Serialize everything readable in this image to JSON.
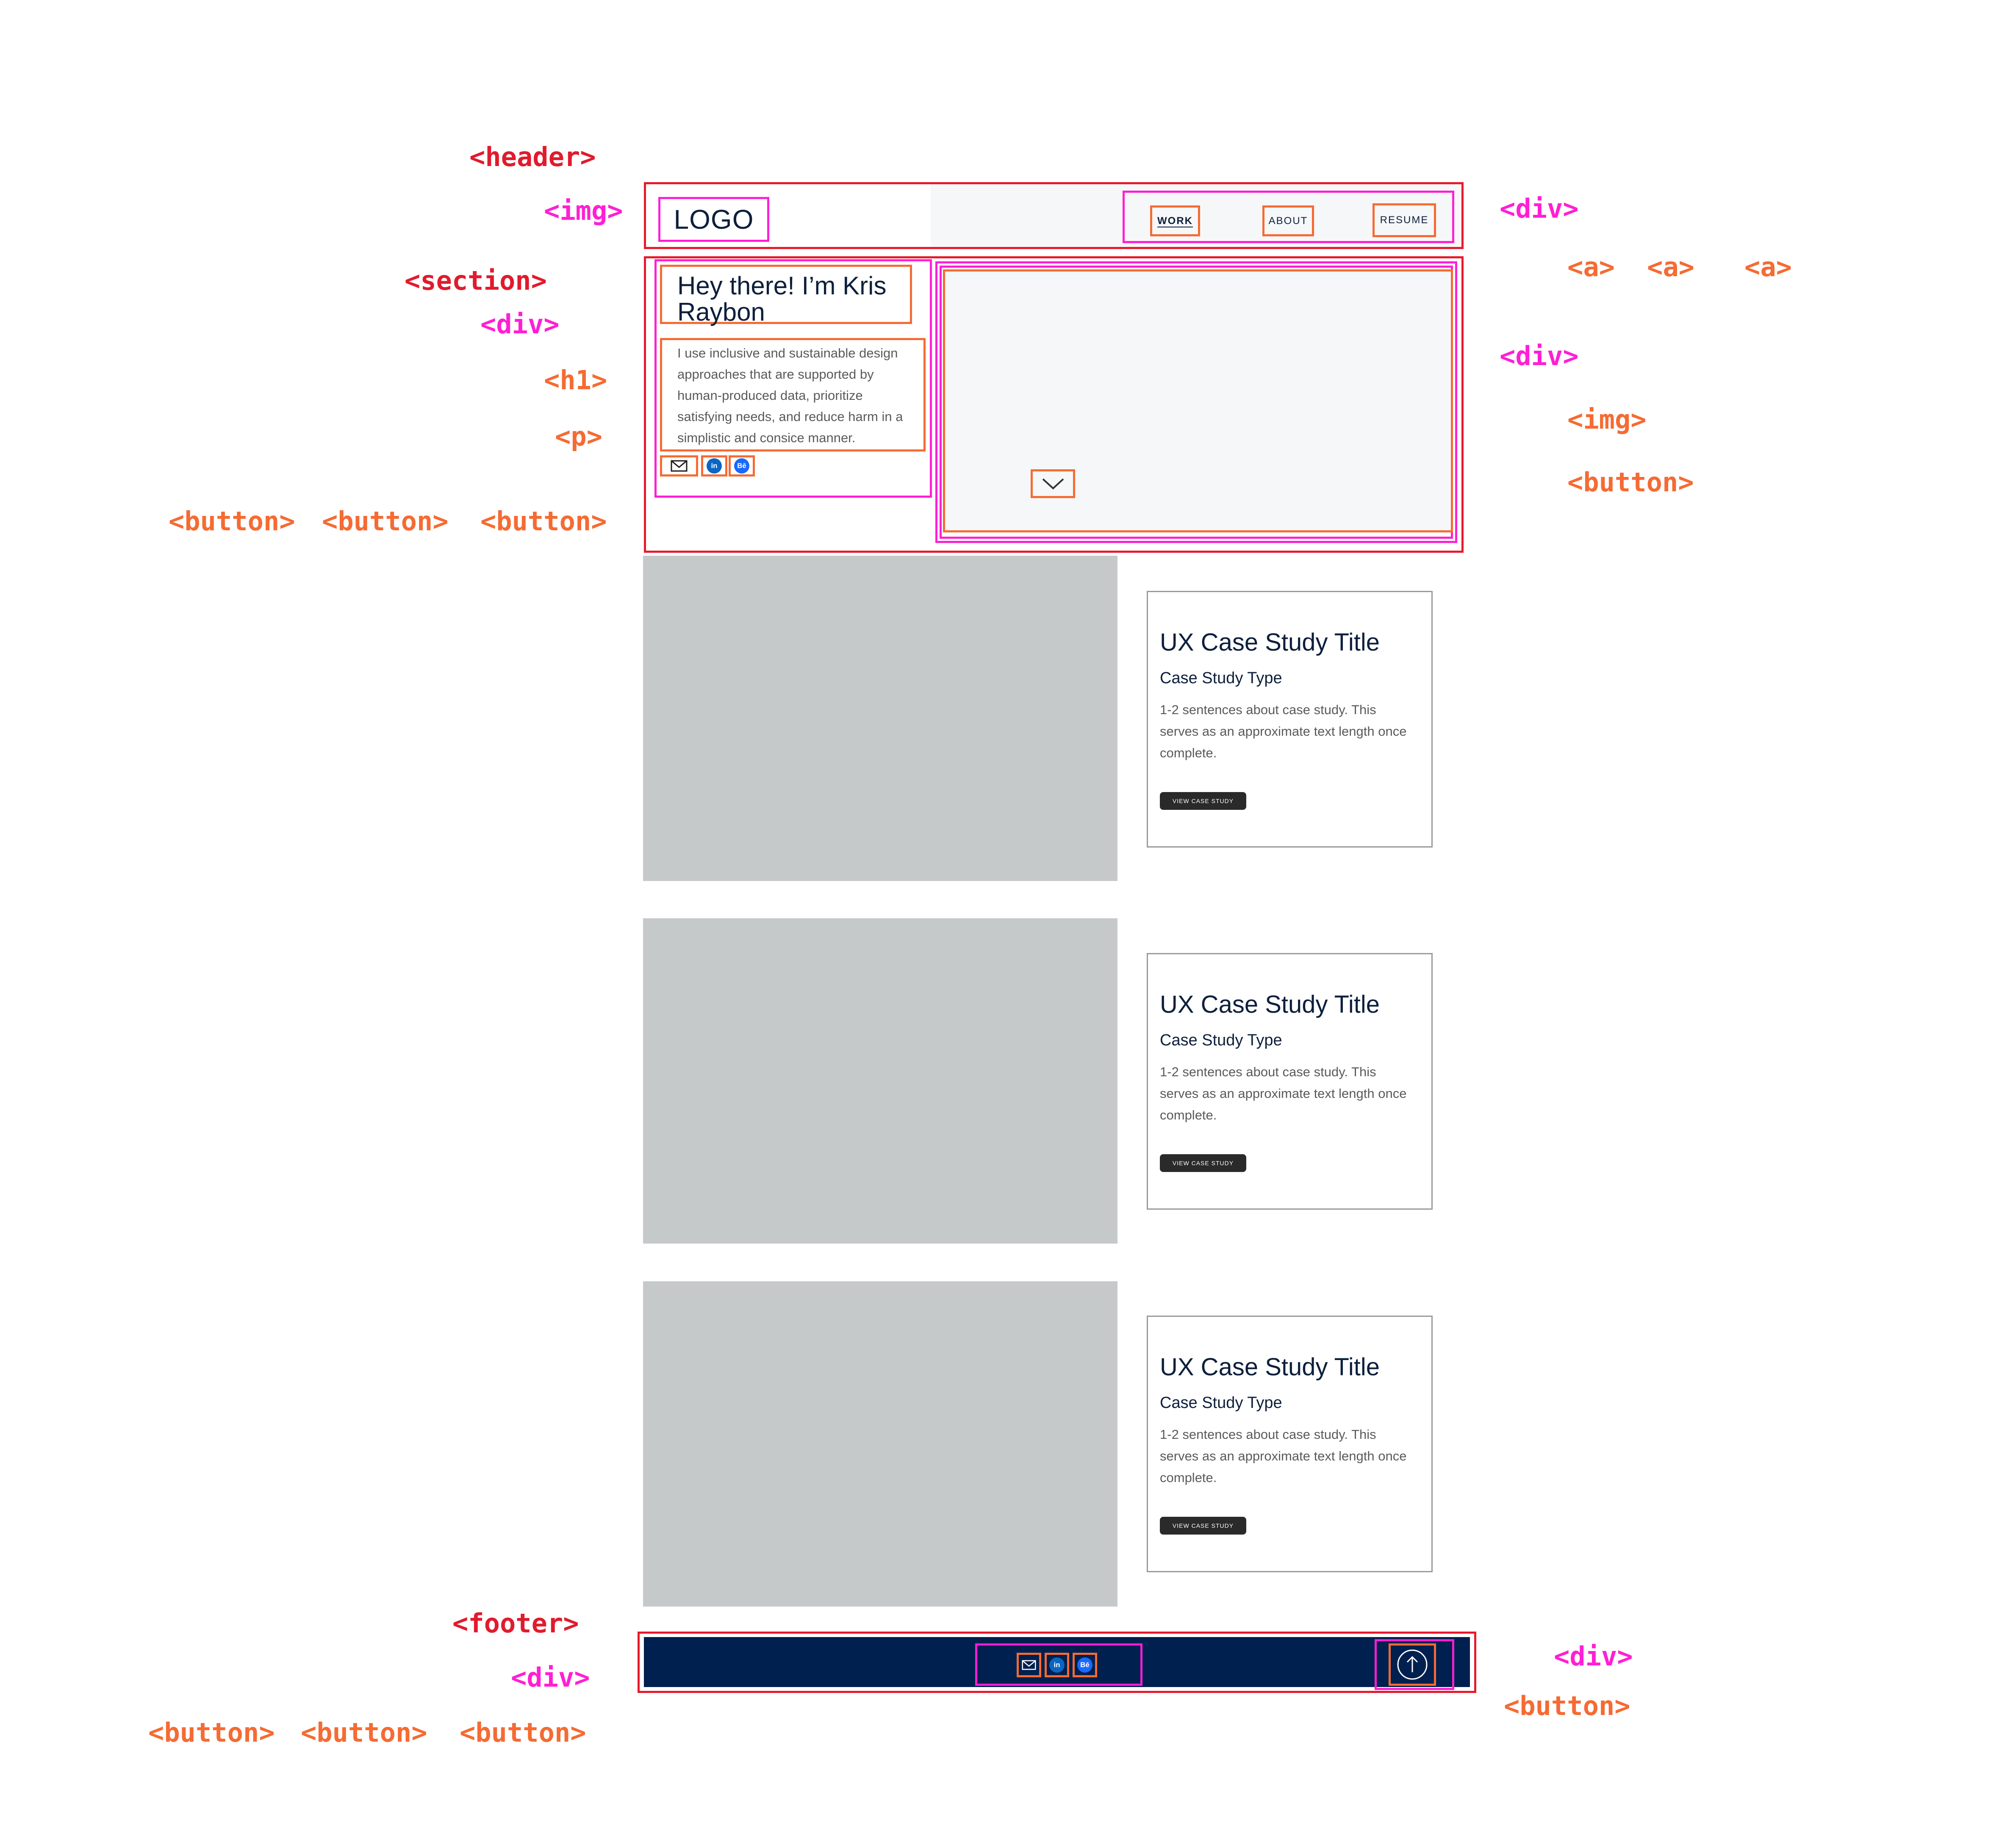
{
  "tags": {
    "header": "<header>",
    "img": "<img>",
    "section": "<section>",
    "div": "<div>",
    "h1": "<h1>",
    "p": "<p>",
    "button": "<button>",
    "a": "<a>",
    "footer": "<footer>"
  },
  "header": {
    "logo": "LOGO",
    "nav": [
      "WORK",
      "ABOUT",
      "RESUME"
    ]
  },
  "hero": {
    "title": "Hey there! I’m Kris Raybon",
    "text": "I use inclusive and sustainable design approaches that are supported by human-produced data, prioritize satisfying needs, and reduce harm in a simplistic and consice manner.",
    "social": [
      "mail-icon",
      "linkedin-icon",
      "behance-icon"
    ],
    "linkedin_label": "in",
    "behance_label": "Bē",
    "scroll_icon": "chevron-down-icon"
  },
  "cases": [
    {
      "title": "UX Case Study Title",
      "type": "Case Study Type",
      "desc": "1-2 sentences about case study. This serves as an approximate text length once complete.",
      "button": "VIEW CASE STUDY"
    },
    {
      "title": "UX Case Study Title",
      "type": "Case Study Type",
      "desc": "1-2 sentences about case study. This serves as an approximate text length once complete.",
      "button": "VIEW CASE STUDY"
    },
    {
      "title": "UX Case Study Title",
      "type": "Case Study Type",
      "desc": "1-2 sentences about case study. This serves as an approximate text length once complete.",
      "button": "VIEW CASE STUDY"
    }
  ],
  "footer": {
    "linkedin_label": "in",
    "behance_label": "Bē",
    "top_icon": "arrow-up-icon"
  },
  "colors": {
    "semantic_outline": "#e8192c",
    "container_outline": "#ff1fd4",
    "element_outline": "#f56b33",
    "navy": "#00204f",
    "placeholder_gray": "#c6c9ca"
  }
}
